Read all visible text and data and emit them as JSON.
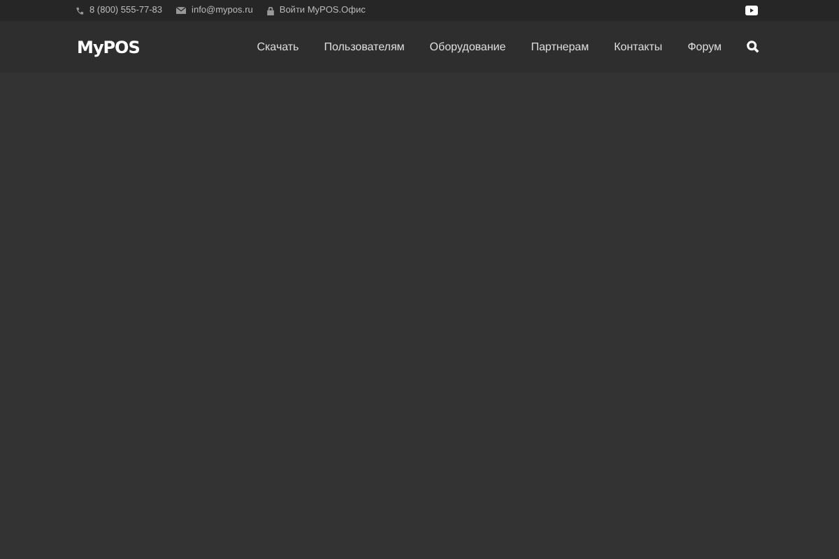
{
  "topbar": {
    "phone": "8 (800) 555-77-83",
    "email": "info@mypos.ru",
    "login": "Войти MyPOS.Офис"
  },
  "header": {
    "logo": "MyPOS",
    "nav": [
      {
        "label": "Скачать"
      },
      {
        "label": "Пользователям"
      },
      {
        "label": "Оборудование"
      },
      {
        "label": "Партнерам"
      },
      {
        "label": "Контакты"
      },
      {
        "label": "Форум"
      }
    ]
  }
}
